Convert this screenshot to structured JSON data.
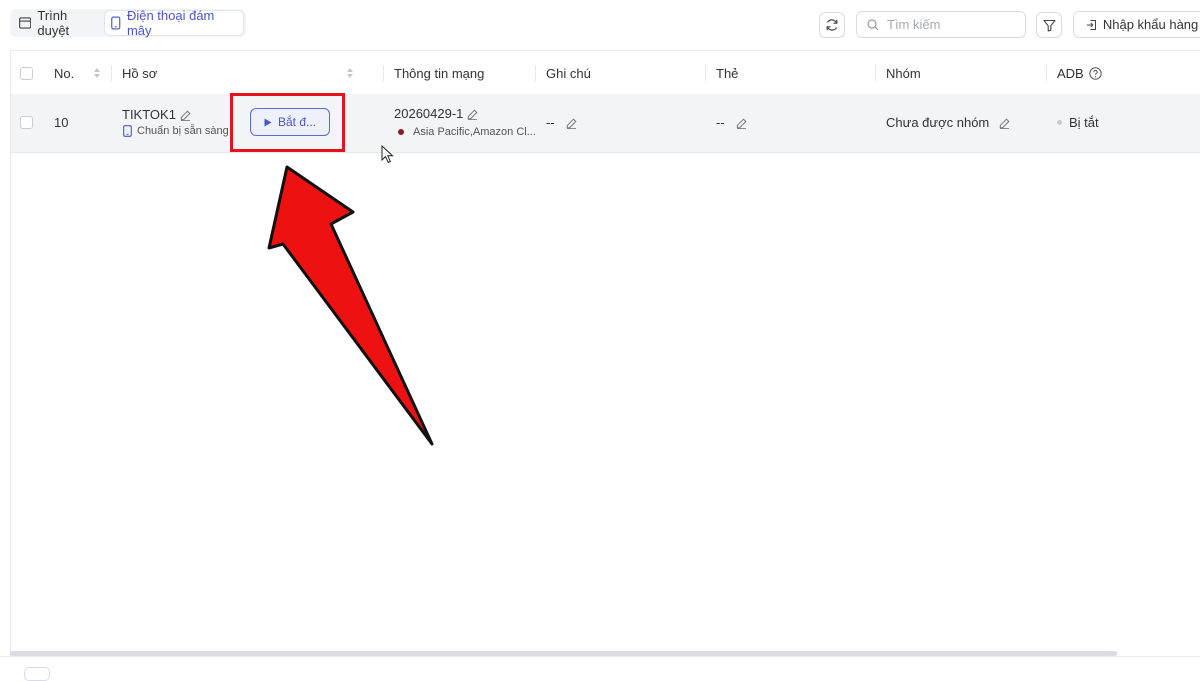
{
  "toolbar": {
    "tabs": [
      {
        "label": "Trình duyệt",
        "icon": "browser-icon",
        "active": false
      },
      {
        "label": "Điện thoại đám mây",
        "icon": "phone-icon",
        "active": true
      }
    ],
    "refresh_icon": "refresh-icon",
    "search_placeholder": "Tìm kiếm",
    "filter_icon": "filter-icon",
    "import_label": "Nhập khẩu hàng lo"
  },
  "table": {
    "columns": {
      "no": "No.",
      "profile": "Hồ sơ",
      "network": "Thông tin mạng",
      "note": "Ghi chú",
      "tag": "Thẻ",
      "group": "Nhóm",
      "adb": "ADB"
    },
    "rows": [
      {
        "no": "10",
        "profile_name": "TIKTOK1",
        "profile_status": "Chuẩn bị sẵn sàng",
        "start_label": "Bắt đ...",
        "network_id": "20260429-1",
        "network_region": "Asia Pacific,Amazon Cl...",
        "note": "--",
        "tag": "--",
        "group": "Chưa được nhóm",
        "adb": "Bị tắt"
      }
    ]
  },
  "colors": {
    "accent": "#4a56c8",
    "highlight": "#e3141c",
    "arrow": "#ee1111",
    "region_dot": "#8b1a2b"
  }
}
